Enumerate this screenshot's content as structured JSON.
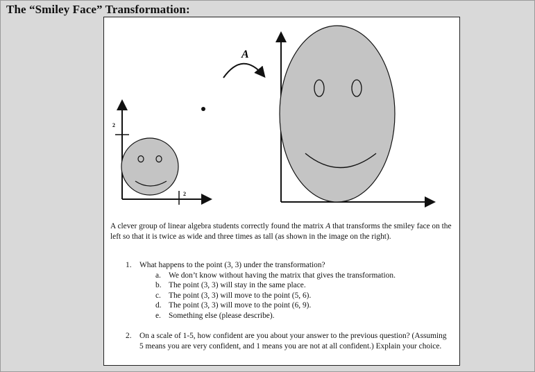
{
  "heading": "The “Smiley Face” Transformation:",
  "figure": {
    "matrix_label": "A",
    "small_y_tick": "2",
    "small_x_tick": "2"
  },
  "paragraph": "A clever group of linear algebra students correctly found the matrix A that transforms the smiley face on the left so that it is twice as wide and three times as tall (as shown in the image on the right).",
  "questions": [
    {
      "number": "1.",
      "text": "What happens to the point (3, 3) under the transformation?",
      "options": [
        {
          "letter": "a.",
          "text": "We don’t know without having the matrix that gives the transformation."
        },
        {
          "letter": "b.",
          "text": "The point (3, 3) will stay in the same place."
        },
        {
          "letter": "c.",
          "text": "The point (3, 3) will move to the point (5, 6)."
        },
        {
          "letter": "d.",
          "text": "The point (3, 3) will move to the point (6, 9)."
        },
        {
          "letter": "e.",
          "text": "Something else (please describe)."
        }
      ]
    },
    {
      "number": "2.",
      "text": "On a scale of 1-5, how confident are you about your answer to the previous question? (Assuming 5 means you are very confident, and 1 means you are not at all confident.) Explain your choice."
    }
  ],
  "colors": {
    "face_fill": "#c4c4c4",
    "ink": "#111111",
    "page_bg": "#d9d9d9"
  }
}
